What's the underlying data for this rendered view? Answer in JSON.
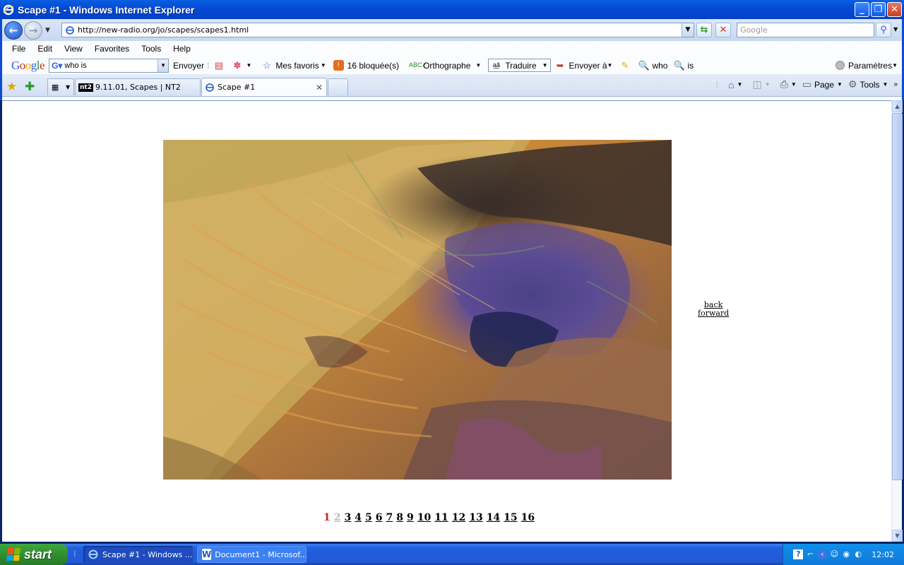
{
  "window": {
    "title": "Scape #1 - Windows Internet Explorer"
  },
  "navigation": {
    "url": "http://new-radio.org/jo/scapes/scapes1.html",
    "search_placeholder": "Google"
  },
  "menu": [
    "File",
    "Edit",
    "View",
    "Favorites",
    "Tools",
    "Help"
  ],
  "google_toolbar": {
    "search_value": "who is",
    "send_label": "Envoyer",
    "favorites_label": "Mes favoris",
    "blocked_label": "16 bloquée(s)",
    "spell_label": "Orthographe",
    "translate_label": "Traduire",
    "sendto_label": "Envoyer à",
    "highlight_1": "who",
    "highlight_2": "is",
    "settings_label": "Paramètres"
  },
  "tabs": [
    {
      "label": "9.11.01, Scapes | NT2",
      "icon": "nt2"
    },
    {
      "label": "Scape #1",
      "icon": "ie-icon"
    }
  ],
  "command_bar": {
    "page_label": "Page",
    "tools_label": "Tools"
  },
  "content": {
    "back_link": "back",
    "forward_link": "forward",
    "current_page": "1",
    "pages": [
      "1",
      "2",
      "3",
      "4",
      "5",
      "6",
      "7",
      "8",
      "9",
      "10",
      "11",
      "12",
      "13",
      "14",
      "15",
      "16"
    ]
  },
  "taskbar": {
    "start_label": "start",
    "tasks": [
      {
        "label": "Scape #1 - Windows ...",
        "icon": "ie-icon",
        "active": true
      },
      {
        "label": "Document1 - Microsof...",
        "icon": "word-icon",
        "active": false
      }
    ],
    "clock": "12:02"
  },
  "colors": {
    "titlebar": "#0449d6",
    "taskbar": "#245edc",
    "start_button": "#2f8f2f",
    "current_page": "#d42020"
  }
}
